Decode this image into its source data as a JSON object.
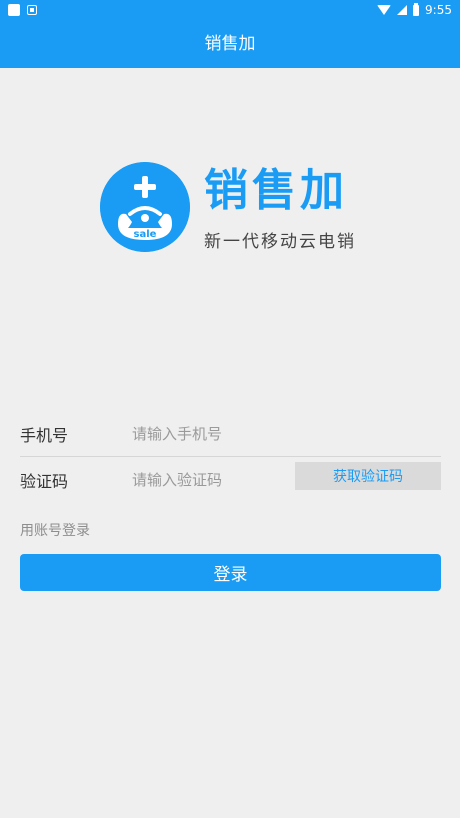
{
  "status_bar": {
    "time": "9:55"
  },
  "app_bar": {
    "title": "销售加"
  },
  "logo": {
    "title": "销售加",
    "slogan": "新一代移动云电销",
    "badge_text": "sale"
  },
  "form": {
    "phone_label": "手机号",
    "phone_placeholder": "请输入手机号",
    "code_label": "验证码",
    "code_placeholder": "请输入验证码",
    "get_code_label": "获取验证码"
  },
  "account_login_label": "用账号登录",
  "login_button_label": "登录",
  "colors": {
    "primary": "#1a9cf5",
    "background": "#efefef",
    "button_gray": "#dadada"
  }
}
